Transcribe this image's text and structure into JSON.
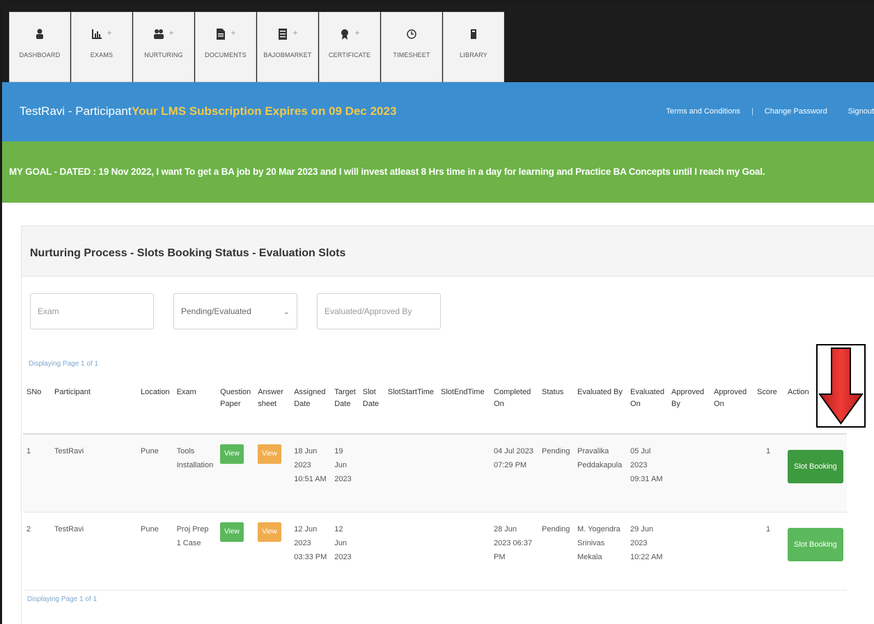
{
  "nav": {
    "tabs": [
      {
        "label": "DASHBOARD",
        "icon": "dashboard-icon",
        "plus": false
      },
      {
        "label": "EXAMS",
        "icon": "bar-chart-icon",
        "plus": true
      },
      {
        "label": "NURTURING",
        "icon": "users-icon",
        "plus": true
      },
      {
        "label": "DOCUMENTS",
        "icon": "document-icon",
        "plus": true
      },
      {
        "label": "BAJOBMARKET",
        "icon": "list-icon",
        "plus": true
      },
      {
        "label": "CERTIFICATE",
        "icon": "certificate-icon",
        "plus": true
      },
      {
        "label": "TIMESHEET",
        "icon": "clock-icon",
        "plus": false
      },
      {
        "label": "LIBRARY",
        "icon": "book-icon",
        "plus": false
      }
    ]
  },
  "header": {
    "brand": "TestRavi - Participant",
    "expiry": "Your LMS Subscription Expires on 09 Dec 2023",
    "terms": "Terms and Conditions",
    "separator": "|",
    "change_password": "Change Password",
    "signout": "Signout"
  },
  "goal": {
    "text": "MY GOAL - DATED : 19 Nov 2022, I want To get a BA job by 20 Mar 2023 and I will invest atleast 8 Hrs time in a day for learning and Practice BA Concepts until I reach my Goal."
  },
  "panel": {
    "title": "Nurturing Process - Slots Booking Status - Evaluation Slots",
    "filters": {
      "exam_placeholder": "Exam",
      "status_value": "Pending/Evaluated",
      "evaluator_placeholder": "Evaluated/Approved By"
    },
    "paging_top": "Displaying Page 1 of 1",
    "paging_bottom": "Displaying Page 1 of 1"
  },
  "table": {
    "headers": [
      "SNo",
      "Participant",
      "Location",
      "Exam",
      "Question Paper",
      "Answer sheet",
      "Assigned Date",
      "Target Date",
      "Slot Date",
      "SlotStartTime",
      "SlotEndTime",
      "Completed On",
      "Status",
      "Evaluated By",
      "Evaluated On",
      "Approved By",
      "Approved On",
      "Score",
      "Action"
    ],
    "rows": [
      {
        "sno": "1",
        "participant": "TestRavi",
        "location": "Pune",
        "exam": "Tools Installation",
        "qp": "View",
        "as": "View",
        "assigned": "18 Jun 2023 10:51 AM",
        "target": "19 Jun 2023",
        "slot_date": "",
        "start": "",
        "end": "",
        "completed": "04 Jul 2023 07:29 PM",
        "status": "Pending",
        "evaluated_by": "Pravalika Peddakapula",
        "evaluated_on": "05 Jul 2023 09:31 AM",
        "approved_by": "",
        "approved_on": "",
        "score": "1",
        "action": "Slot Booking"
      },
      {
        "sno": "2",
        "participant": "TestRavi",
        "location": "Pune",
        "exam": "Proj Prep 1 Case",
        "qp": "View",
        "as": "View",
        "assigned": "12 Jun 2023 03:33 PM",
        "target": "12 Jun 2023",
        "slot_date": "",
        "start": "",
        "end": "",
        "completed": "28 Jun 2023 06:37 PM",
        "status": "Pending",
        "evaluated_by": "M. Yogendra Srinivas Mekala",
        "evaluated_on": "29 Jun 2023 10:22 AM",
        "approved_by": "",
        "approved_on": "",
        "score": "1",
        "action": "Slot Booking"
      }
    ]
  },
  "colors": {
    "nav_bg": "#1c1c1c",
    "header_blue": "#3b8fd0",
    "expiry_yellow": "#f2c94c",
    "goal_green": "#6db348",
    "btn_green": "#5cb85c",
    "btn_orange": "#f0ad4e",
    "arrow_red": "#e3342f"
  }
}
